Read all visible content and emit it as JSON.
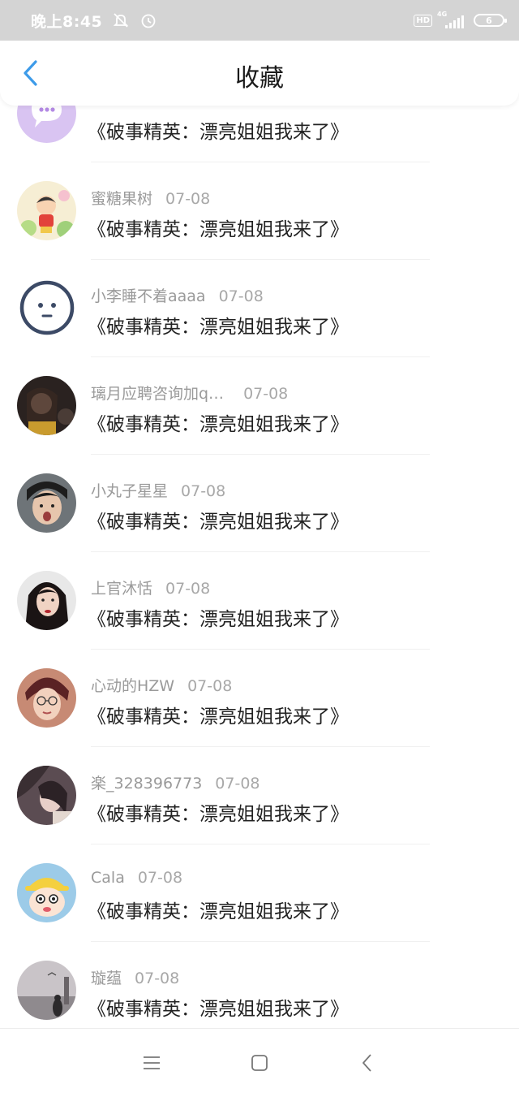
{
  "status_bar": {
    "time": "晚上8:45",
    "hd_label": "HD",
    "network": "4G",
    "battery": "6",
    "icons": [
      "bell-off-icon",
      "alarm-icon"
    ]
  },
  "header": {
    "title": "收藏",
    "back_icon": "chevron-left-icon"
  },
  "colors": {
    "accent": "#3d9be9",
    "status_bar_bg": "#d4d4d4",
    "meta_text": "#9a9a9a",
    "title_text": "#222222"
  },
  "items": [
    {
      "username": "",
      "date": "",
      "title": "《破事精英：漂亮姐姐我来了》",
      "avatar": "chat-bubble-avatar"
    },
    {
      "username": "蜜糖果树",
      "date": "07-08",
      "title": "《破事精英：漂亮姐姐我来了》",
      "avatar": "cartoon-avatar"
    },
    {
      "username": "小李睡不着aaaa",
      "date": "07-08",
      "title": "《破事精英：漂亮姐姐我来了》",
      "avatar": "face-avatar"
    },
    {
      "username": "璃月应聘咨询加q…",
      "date": "07-08",
      "title": "《破事精英：漂亮姐姐我来了》",
      "avatar": "photo-avatar"
    },
    {
      "username": "小丸子星星",
      "date": "07-08",
      "title": "《破事精英：漂亮姐姐我来了》",
      "avatar": "photo-avatar"
    },
    {
      "username": "上官沐恬",
      "date": "07-08",
      "title": "《破事精英：漂亮姐姐我来了》",
      "avatar": "photo-avatar"
    },
    {
      "username": "心动的HZW",
      "date": "07-08",
      "title": "《破事精英：漂亮姐姐我来了》",
      "avatar": "photo-avatar"
    },
    {
      "username": "楽_328396773",
      "date": "07-08",
      "title": "《破事精英：漂亮姐姐我来了》",
      "avatar": "photo-avatar"
    },
    {
      "username": "Cala",
      "date": "07-08",
      "title": "《破事精英：漂亮姐姐我来了》",
      "avatar": "cartoon-avatar"
    },
    {
      "username": "璇蕴",
      "date": "07-08",
      "title": "《破事精英：漂亮姐姐我来了》",
      "avatar": "photo-avatar"
    }
  ],
  "nav_bar": {
    "icons": [
      "menu-icon",
      "home-square-icon",
      "back-triangle-icon"
    ]
  }
}
